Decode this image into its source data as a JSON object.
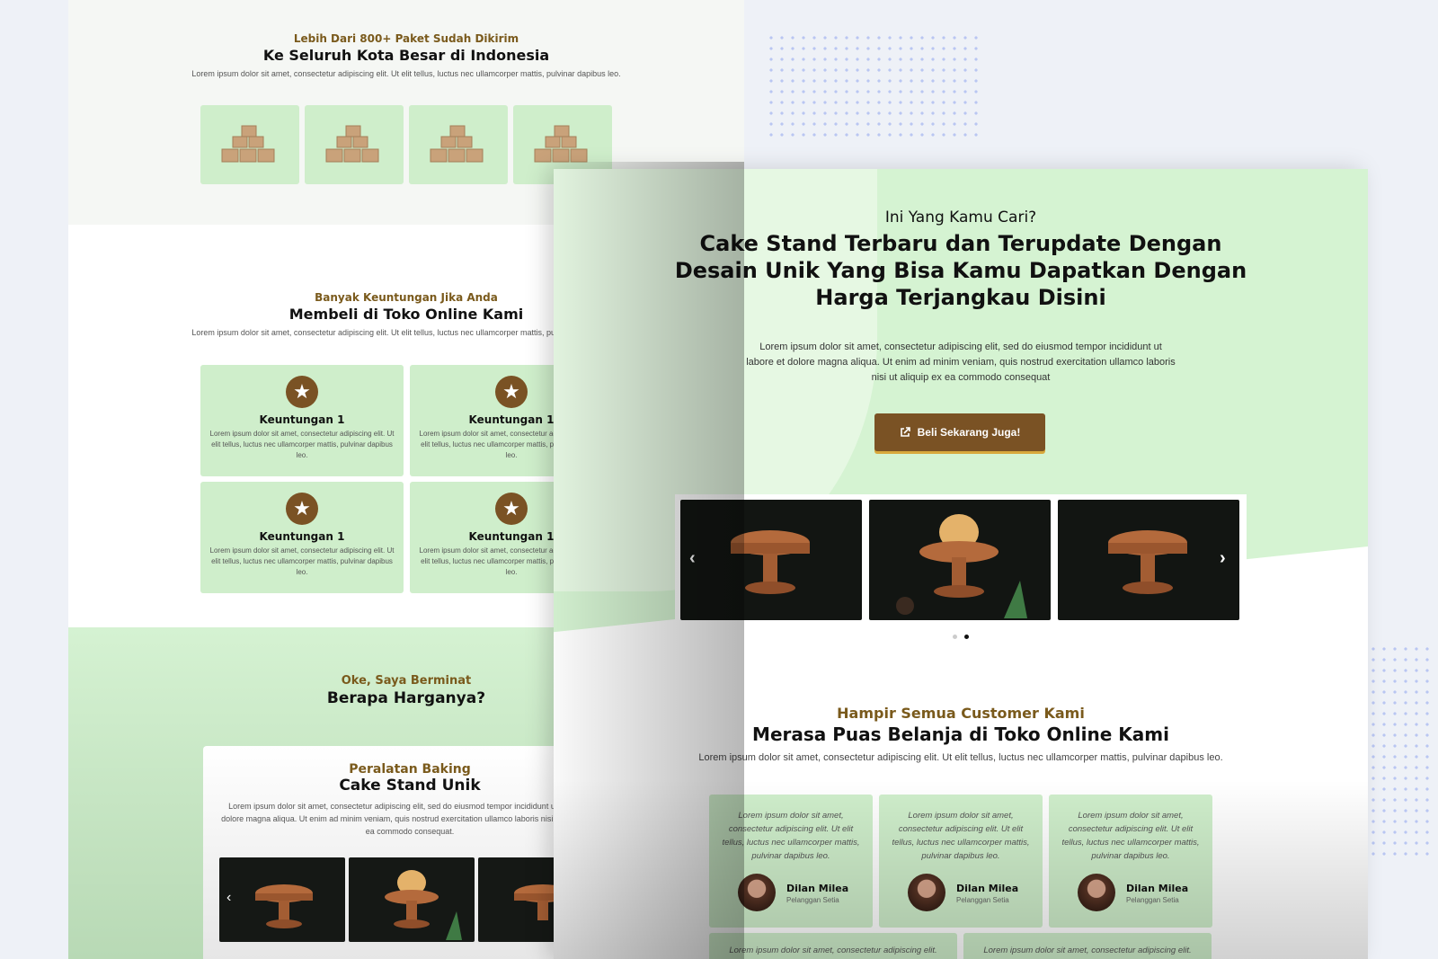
{
  "back_page": {
    "shipping": {
      "eyebrow": "Lebih Dari 800+ Paket Sudah Dikirim",
      "title": "Ke Seluruh Kota Besar di Indonesia",
      "desc": "Lorem ipsum dolor sit amet, consectetur adipiscing elit. Ut elit tellus, luctus nec ullamcorper mattis, pulvinar dapibus leo."
    },
    "benefits": {
      "eyebrow": "Banyak Keuntungan Jika Anda",
      "title": "Membeli di Toko Online Kami",
      "desc": "Lorem ipsum dolor sit amet, consectetur adipiscing elit. Ut elit tellus, luctus nec ullamcorper mattis, pulvinar dapibus leo.",
      "items": [
        {
          "title": "Keuntungan 1",
          "desc": "Lorem ipsum dolor sit amet, consectetur adipiscing elit. Ut elit tellus, luctus nec ullamcorper mattis, pulvinar dapibus leo."
        },
        {
          "title": "Keuntungan 1",
          "desc": "Lorem ipsum dolor sit amet, consectetur adipiscing elit. Ut elit tellus, luctus nec ullamcorper mattis, pulvinar dapibus leo."
        },
        {
          "title": "Keuntungan 1",
          "desc": "Lorem ipsum dolor sit amet, consectetur adipiscing elit. Ut elit tellus, luctus nec ullamcorper mattis, pulvinar dapibus leo."
        },
        {
          "title": "Keuntungan 1",
          "desc": "Lorem ipsum dolor sit amet, consectetur adipiscing elit. Ut elit tellus, luctus nec ullamcorper mattis, pulvinar dapibus leo."
        }
      ]
    },
    "price": {
      "eyebrow": "Oke, Saya Berminat",
      "title": "Berapa Harganya?",
      "card_eyebrow": "Peralatan Baking",
      "card_title": "Cake Stand Unik",
      "card_desc": "Lorem ipsum dolor sit amet, consectetur adipiscing elit, sed do eiusmod tempor incididunt ut labore et dolore magna aliqua. Ut enim ad minim veniam, quis nostrud exercitation ullamco laboris nisi ut aliquip ex ea commodo consequat."
    }
  },
  "front_page": {
    "hero": {
      "eyebrow": "Ini Yang Kamu Cari?",
      "title": "Cake Stand Terbaru dan Terupdate Dengan Desain Unik Yang Bisa Kamu Dapatkan Dengan Harga Terjangkau Disini",
      "desc": "Lorem ipsum dolor sit amet, consectetur adipiscing elit, sed do eiusmod tempor incididunt ut labore et dolore magna aliqua. Ut enim ad minim veniam, quis nostrud exercitation ullamco laboris nisi ut aliquip ex ea commodo consequat",
      "cta_label": "Beli Sekarang Juga!",
      "cta_icon": "external-link-icon"
    },
    "testimonials": {
      "eyebrow": "Hampir Semua Customer Kami",
      "title": "Merasa Puas Belanja di Toko Online Kami",
      "desc": "Lorem ipsum dolor sit amet, consectetur adipiscing elit. Ut elit tellus, luctus nec ullamcorper mattis, pulvinar dapibus leo.",
      "items": [
        {
          "quote": "Lorem ipsum dolor sit amet, consectetur adipiscing elit. Ut elit tellus, luctus nec ullamcorper mattis, pulvinar dapibus leo.",
          "name": "Dilan Milea",
          "role": "Pelanggan Setia"
        },
        {
          "quote": "Lorem ipsum dolor sit amet, consectetur adipiscing elit. Ut elit tellus, luctus nec ullamcorper mattis, pulvinar dapibus leo.",
          "name": "Dilan Milea",
          "role": "Pelanggan Setia"
        },
        {
          "quote": "Lorem ipsum dolor sit amet, consectetur adipiscing elit. Ut elit tellus, luctus nec ullamcorper mattis, pulvinar dapibus leo.",
          "name": "Dilan Milea",
          "role": "Pelanggan Setia"
        }
      ],
      "more": [
        "Lorem ipsum dolor sit amet, consectetur adipiscing elit.",
        "Lorem ipsum dolor sit amet, consectetur adipiscing elit."
      ]
    },
    "slider": {
      "prev_icon": "chevron-left-icon",
      "next_icon": "chevron-right-icon",
      "active_dot": 2,
      "dot_count": 2
    }
  },
  "colors": {
    "brand_brown": "#7a5224",
    "eyebrow_brown": "#7a5a1c",
    "mint": "#cfeecb",
    "cta_shadow": "#d8a83c"
  }
}
